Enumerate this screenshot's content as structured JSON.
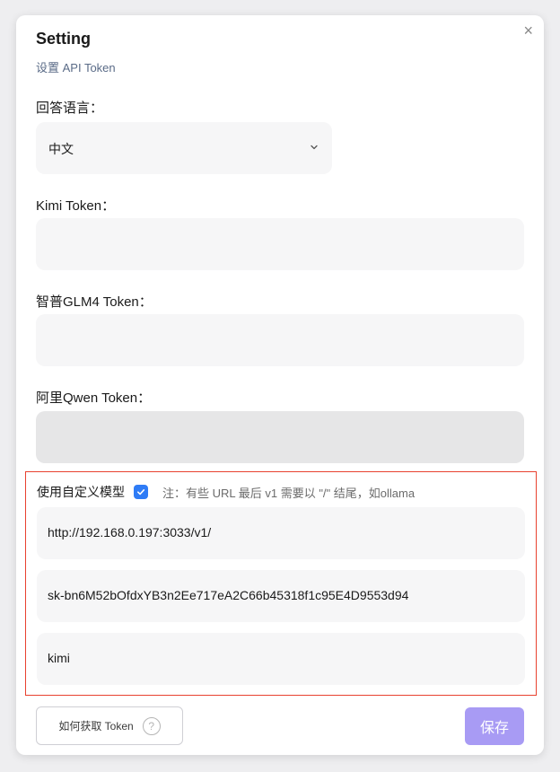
{
  "dialog": {
    "title": "Setting",
    "subtitle": "设置 API Token",
    "close_glyph": "×"
  },
  "language": {
    "label": "回答语言：",
    "selected": "中文",
    "icon": "chevron-down-icon"
  },
  "kimi": {
    "label": "Kimi Token：",
    "value": ""
  },
  "zhipu": {
    "label": "智普GLM4 Token：",
    "value": ""
  },
  "qwen": {
    "label": "阿里Qwen Token：",
    "value": "",
    "disabled": true
  },
  "custom_model": {
    "label": "使用自定义模型",
    "checked": true,
    "note": "注：有些 URL 最后 v1 需要以 \"/\" 结尾，如ollama",
    "url": "http://192.168.0.197:3033/v1/",
    "api_key": "sk-bn6M52bOfdxYB3n2Ee717eA2C66b45318f1c95E4D9553d94",
    "model": "kimi",
    "border_color": "#e8412f"
  },
  "footer": {
    "help_label": "如何获取 Token",
    "help_icon_glyph": "?",
    "save_label": "保存",
    "save_color": "#a89bf4"
  }
}
